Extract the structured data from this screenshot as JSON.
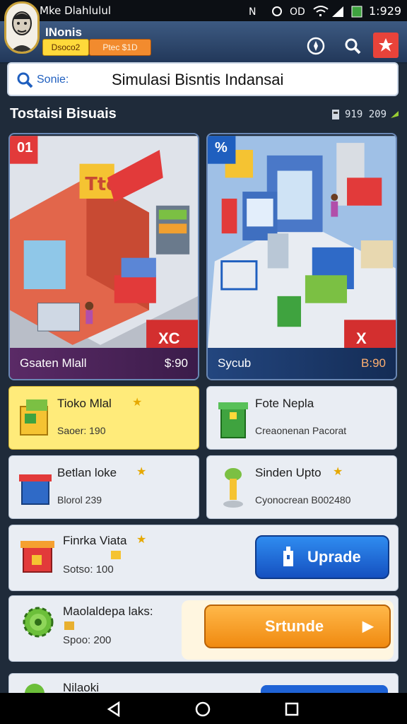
{
  "status_bar": {
    "carrier": "Mke Dlahlulul",
    "time": "1:929",
    "icons": [
      "mute-icon",
      "alarm-icon",
      "loop-icon",
      "wifi-icon",
      "signal-icon",
      "battery-icon"
    ]
  },
  "header": {
    "app_name": "INonis",
    "chip_level": "Dsoco2",
    "chip_coins": "Ptec $1D",
    "icons": [
      "compass-icon",
      "search-icon",
      "alert-icon"
    ]
  },
  "search": {
    "label": "Sonie:",
    "value": "Simulasi Bisntis Indansai"
  },
  "section": {
    "title": "Tostaisi Bisuais",
    "balance": "919 209"
  },
  "featured": [
    {
      "badge": "01",
      "corner": "XC",
      "name": "Gsaten Mlall",
      "price": "$:90"
    },
    {
      "badge": "%",
      "corner": "X",
      "name": "Sycub",
      "price": "B:90"
    }
  ],
  "tiles": [
    {
      "name": "Tioko Mlal",
      "sub": "Saoer: 190",
      "highlight": true,
      "icon": "store-box-icon"
    },
    {
      "name": "Fote Nepla",
      "sub": "Creaonenan Pacorat",
      "highlight": false,
      "icon": "trash-bin-icon"
    },
    {
      "name": "Betlan loke",
      "sub": "Blorol 239",
      "highlight": false,
      "icon": "basket-icon"
    },
    {
      "name": "Sinden Upto",
      "sub": "Cyonocrean B002480",
      "highlight": false,
      "icon": "trophy-icon"
    }
  ],
  "rows": [
    {
      "name": "Finrka Viata",
      "sub": "Sotso: 100",
      "button": "Uprade",
      "icon": "shop-icon"
    },
    {
      "name": "Maolaldepa laks:",
      "sub": "Spoo: 200",
      "button": "Srtunde",
      "icon": "gear-icon"
    },
    {
      "name": "Nilaoki"
    }
  ],
  "colors": {
    "header": "#2c4468",
    "accent_blue": "#1d6fe0",
    "accent_orange": "#f39a1a",
    "highlight": "#ffeb7a",
    "card_footer_left": "#4a2458",
    "card_footer_right": "#1f3f73"
  }
}
